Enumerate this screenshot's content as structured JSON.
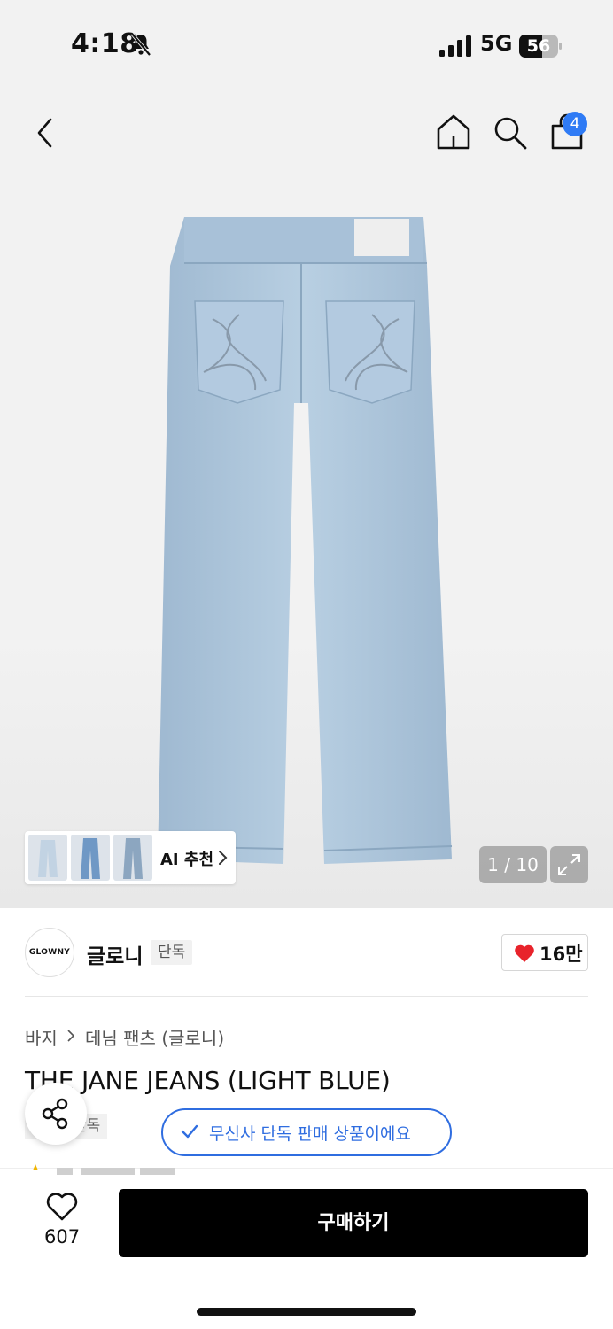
{
  "status_bar": {
    "time": "4:18",
    "network": "5G",
    "battery": "56",
    "icons": [
      "bell-slash-icon",
      "signal-icon",
      "battery-icon"
    ]
  },
  "header": {
    "icons": [
      "back-arrow-icon",
      "home-icon",
      "search-icon",
      "shopping-bag-icon"
    ],
    "cart_count": "4"
  },
  "gallery": {
    "ai_recommend_label": "AI 추천",
    "page_indicator": "1 / 10",
    "expand_icon": "expand-icon"
  },
  "brand": {
    "logo_text": "GLOWNY",
    "name": "글로니",
    "tag": "단독",
    "likes": "16만"
  },
  "breadcrumb": {
    "level1": "바지",
    "level2": "데님 팬츠 (글로니)"
  },
  "product": {
    "title": "THE JANE JEANS (LIGHT BLUE)",
    "tag": "단독"
  },
  "notice": {
    "text": "무신사 단독 판매 상품이에요"
  },
  "bottom": {
    "wish_count": "607",
    "buy_label": "구매하기"
  },
  "colors": {
    "accent_blue": "#2f6de0",
    "badge_blue": "#2f7bf5",
    "heart_red": "#e8232b",
    "denim": "#a9c3da"
  }
}
